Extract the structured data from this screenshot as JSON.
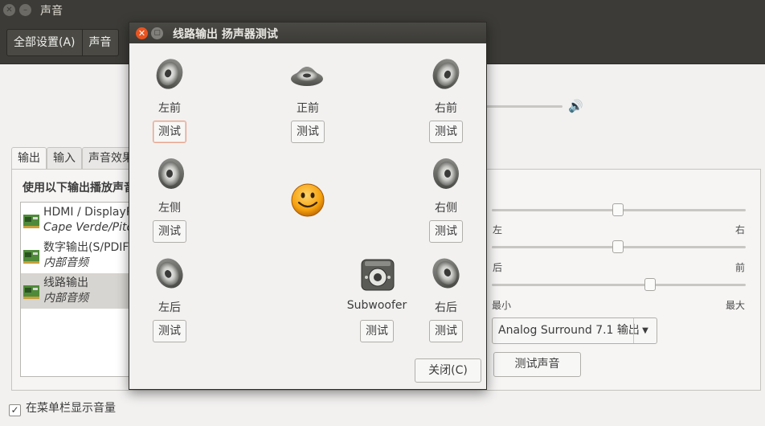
{
  "main_window": {
    "title": "声音",
    "breadcrumbs": [
      "全部设置(A)",
      "声音"
    ],
    "tabs": [
      "输出",
      "输入",
      "声音效果"
    ],
    "section_heading": "使用以下输出播放声音",
    "devices": [
      {
        "name": "HDMI / DisplayPort",
        "sub": "Cape Verde/Pitcairn HDMI Audio"
      },
      {
        "name": "数字输出(S/PDIF)",
        "sub": "内部音频"
      },
      {
        "name": "线路输出",
        "sub": "内部音频",
        "selected": true
      }
    ],
    "balance": {
      "left_label": "左",
      "right_label": "右",
      "value": 0.5
    },
    "fade": {
      "left_label": "后",
      "right_label": "前",
      "value": 0.5
    },
    "subwoofer": {
      "left_label": "最小",
      "right_label": "最大",
      "value": 0.6
    },
    "output_volume_level": 0.8,
    "profile_selected": "Analog Surround 7.1 输出",
    "test_sound_button": "测试声音",
    "show_volume_checkbox": {
      "label": "在菜单栏显示音量",
      "checked": true
    }
  },
  "dialog": {
    "title": "线路输出 扬声器测试",
    "speakers": {
      "front_left": "左前",
      "front_center": "正前",
      "front_right": "右前",
      "side_left": "左侧",
      "side_right": "右侧",
      "rear_left": "左后",
      "subwoofer": "Subwoofer",
      "rear_right": "右后"
    },
    "test_label": "测试",
    "close_button": "关闭(C)"
  },
  "colors": {
    "titlebar": "#3c3b37",
    "accent_orange": "#e95420",
    "window_bg": "#f2f1f0"
  }
}
